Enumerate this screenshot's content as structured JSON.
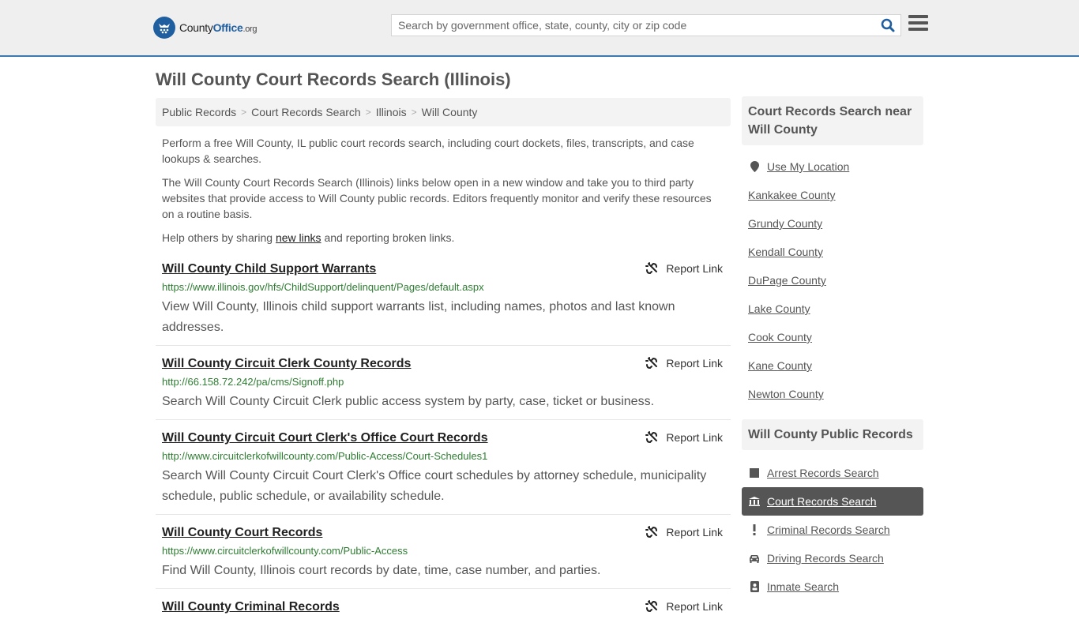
{
  "header": {
    "logo_text_main": "County",
    "logo_text_brand": "Office",
    "logo_text_tld": ".org",
    "search_placeholder": "Search by government office, state, county, city or zip code",
    "search_icon": "search-icon",
    "menu_icon": "hamburger-menu-icon",
    "accent_color": "#3a7ab0",
    "brand_color": "#1f5fa0"
  },
  "page": {
    "title": "Will County Court Records Search (Illinois)"
  },
  "breadcrumb": [
    {
      "label": "Public Records"
    },
    {
      "label": "Court Records Search"
    },
    {
      "label": "Illinois"
    },
    {
      "label": "Will County"
    }
  ],
  "breadcrumb_separator": ">",
  "intro": {
    "p1": "Perform a free Will County, IL public court records search, including court dockets, files, transcripts, and case lookups & searches.",
    "p2": "The Will County Court Records Search (Illinois) links below open in a new window and take you to third party websites that provide access to Will County public records. Editors frequently monitor and verify these resources on a routine basis.",
    "p3_before": "Help others by sharing ",
    "p3_link": "new links",
    "p3_after": " and reporting broken links."
  },
  "report_label": "Report Link",
  "results": [
    {
      "title": "Will County Child Support Warrants",
      "url": "https://www.illinois.gov/hfs/ChildSupport/delinquent/Pages/default.aspx",
      "desc": "View Will County, Illinois child support warrants list, including names, photos and last known addresses."
    },
    {
      "title": "Will County Circuit Clerk County Records",
      "url": "http://66.158.72.242/pa/cms/Signoff.php",
      "desc": "Search Will County Circuit Clerk public access system by party, case, ticket or business."
    },
    {
      "title": "Will County Circuit Court Clerk's Office Court Records",
      "url": "http://www.circuitclerkofwillcounty.com/Public-Access/Court-Schedules1",
      "desc": "Search Will County Circuit Court Clerk's Office court schedules by attorney schedule, municipality schedule, public schedule, or availability schedule."
    },
    {
      "title": "Will County Court Records",
      "url": "https://www.circuitclerkofwillcounty.com/Public-Access",
      "desc": "Find Will County, Illinois court records by date, time, case number, and parties."
    },
    {
      "title": "Will County Criminal Records",
      "url": "",
      "desc": ""
    }
  ],
  "sidebar": {
    "nearby_heading": "Court Records Search near Will County",
    "use_location": "Use My Location",
    "nearby": [
      "Kankakee County",
      "Grundy County",
      "Kendall County",
      "DuPage County",
      "Lake County",
      "Cook County",
      "Kane County",
      "Newton County"
    ],
    "public_heading": "Will County Public Records",
    "public_records": [
      {
        "label": "Arrest Records Search",
        "icon": "square-icon",
        "active": false
      },
      {
        "label": "Court Records Search",
        "icon": "courthouse-icon",
        "active": true
      },
      {
        "label": "Criminal Records Search",
        "icon": "exclamation-icon",
        "active": false
      },
      {
        "label": "Driving Records Search",
        "icon": "car-icon",
        "active": false
      },
      {
        "label": "Inmate Search",
        "icon": "id-badge-icon",
        "active": false
      }
    ]
  }
}
